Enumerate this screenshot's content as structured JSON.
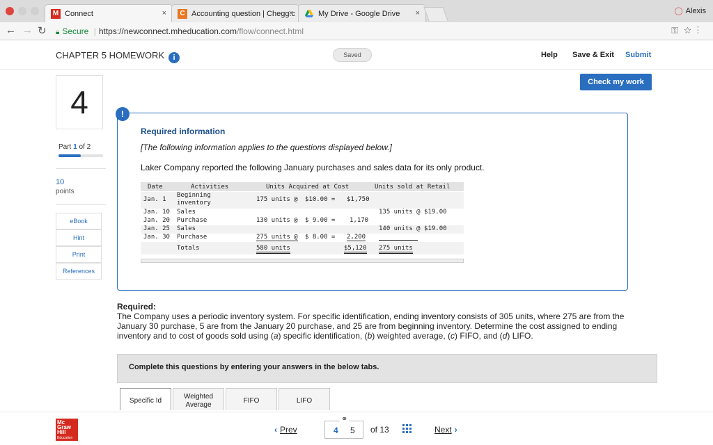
{
  "browser": {
    "tabs": [
      {
        "label": "Connect",
        "favicon": "mcgraw-hill-icon",
        "active": true
      },
      {
        "label": "Accounting question | Chegg.c",
        "favicon": "chegg-icon",
        "active": false
      },
      {
        "label": "My Drive - Google Drive",
        "favicon": "google-drive-icon",
        "active": false
      }
    ],
    "profile_name": "Alexis",
    "url_secure_label": "Secure",
    "url_host": "https://newconnect.mheducation.com",
    "url_path": "/flow/connect.html"
  },
  "header": {
    "chapter_title": "CHAPTER 5 HOMEWORK",
    "saved_label": "Saved",
    "help_label": "Help",
    "save_exit_label": "Save & Exit",
    "submit_label": "Submit"
  },
  "question": {
    "number": "4",
    "part_label": "Part",
    "part_current": "1",
    "part_of": "of 2",
    "part_progress_fraction": 0.5,
    "points_value": "10",
    "points_label": "points",
    "side_buttons": [
      "eBook",
      "Hint",
      "Print",
      "References"
    ],
    "check_work_label": "Check my work"
  },
  "info": {
    "title": "Required information",
    "italic_note": "[The following information applies to the questions displayed below.]",
    "intro": "Laker Company reported the following January purchases and sales data for its only product."
  },
  "table": {
    "headers": [
      "Date",
      "Activities",
      "Units Acquired at Cost",
      "Units sold at Retail"
    ],
    "rows": [
      {
        "date": "Jan. 1",
        "activity_line1": "Beginning",
        "activity_line2": "inventory",
        "acquired_units": "175 units @",
        "acquired_cost": "$10.00 =",
        "acquired_total": "$1,750",
        "sold": ""
      },
      {
        "date": "Jan. 10",
        "activity_line1": "Sales",
        "activity_line2": "",
        "acquired_units": "",
        "acquired_cost": "",
        "acquired_total": "",
        "sold": "135 units @  $19.00"
      },
      {
        "date": "Jan. 20",
        "activity_line1": "Purchase",
        "activity_line2": "",
        "acquired_units": "130 units @",
        "acquired_cost": "$ 9.00 =",
        "acquired_total": "1,170",
        "sold": ""
      },
      {
        "date": "Jan. 25",
        "activity_line1": "Sales",
        "activity_line2": "",
        "acquired_units": "",
        "acquired_cost": "",
        "acquired_total": "",
        "sold": "140 units @  $19.00"
      },
      {
        "date": "Jan. 30",
        "activity_line1": "Purchase",
        "activity_line2": "",
        "acquired_units": "275 units @",
        "acquired_cost": "$ 8.00 =",
        "acquired_total": "2,200",
        "sold": ""
      }
    ],
    "totals": {
      "label": "Totals",
      "acquired_units": "580 units",
      "acquired_total": "$5,120",
      "sold": "275 units"
    }
  },
  "required": {
    "heading": "Required:",
    "text_part1": "The Company uses a periodic inventory system. For specific identification, ending inventory consists of 305 units, where 275 are from the January 30 purchase, 5 are from the January 20 purchase, and 25 are from beginning inventory. Determine the cost assigned to ending inventory and to cost of goods sold using (",
    "a": "a",
    "t_a": ") specific identification, (",
    "b": "b",
    "t_b": ") weighted average, (",
    "c": "c",
    "t_c": ") FIFO, and (",
    "d": "d",
    "t_d": ") LIFO."
  },
  "complete_box_label": "Complete this questions by entering your answers in the below tabs.",
  "answer_tabs": [
    {
      "line1": "Specific Id",
      "line2": ""
    },
    {
      "line1": "Weighted",
      "line2": "Average"
    },
    {
      "line1": "FIFO",
      "line2": ""
    },
    {
      "line1": "LIFO",
      "line2": ""
    }
  ],
  "footer": {
    "logo_line1": "Mc",
    "logo_line2": "Graw",
    "logo_line3": "Hill",
    "logo_line4": "Education",
    "prev_label": "Prev",
    "current_page": "4",
    "next_page": "5",
    "of_label": "of 13",
    "next_label": "Next"
  },
  "colors": {
    "accent": "#2a6ebf",
    "brand": "#d52b1e"
  }
}
